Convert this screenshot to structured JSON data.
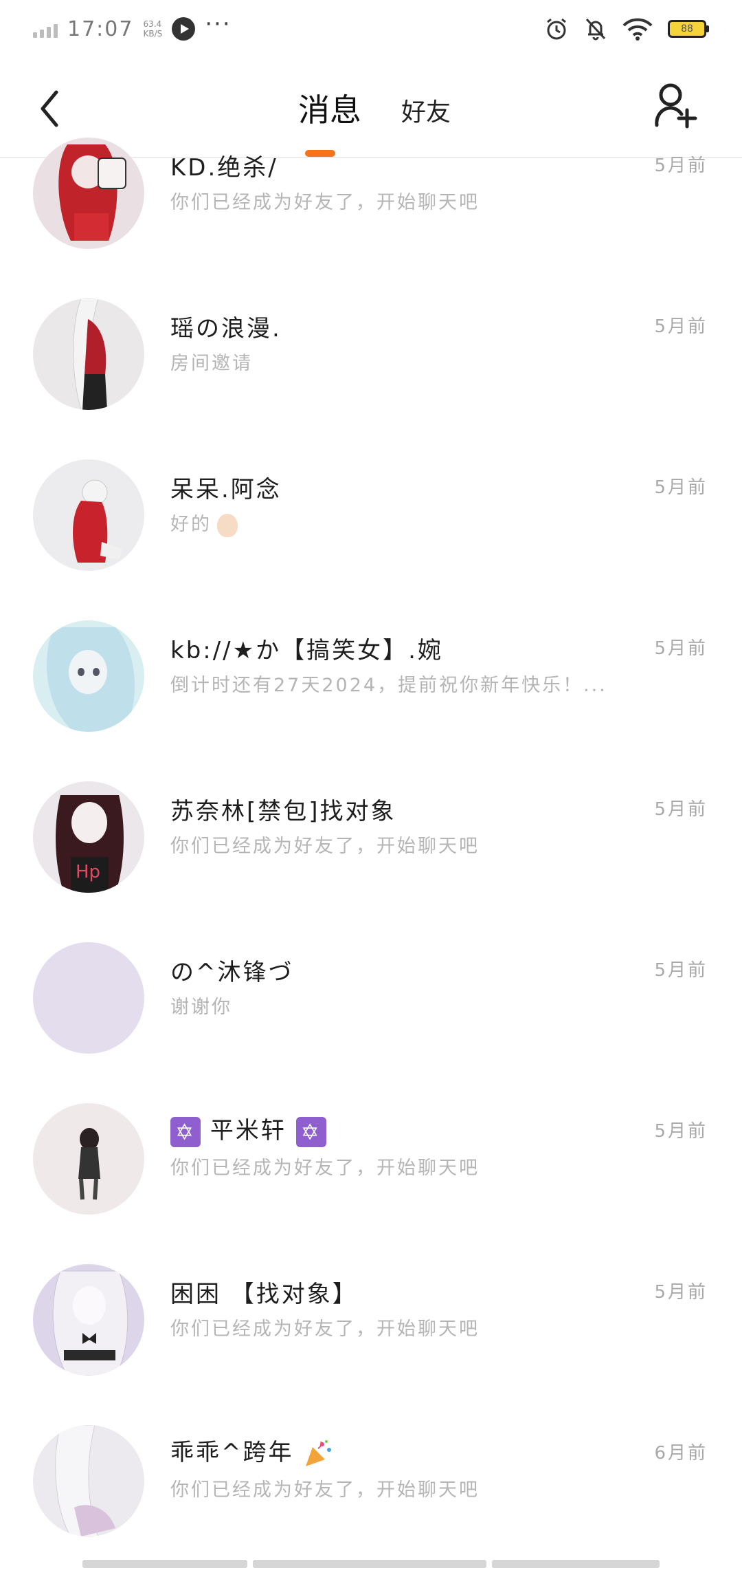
{
  "status_bar": {
    "time": "17:07",
    "speed_value": "63.4",
    "speed_unit": "KB/S",
    "more": "···",
    "battery": "88"
  },
  "header": {
    "tab_messages": "消息",
    "tab_friends": "好友",
    "accent_color": "#f5731c"
  },
  "conversations": [
    {
      "name": "KD.绝杀/",
      "preview": "你们已经成为好友了，开始聊天吧",
      "time": "5月前"
    },
    {
      "name": "瑶の浪漫.",
      "preview": "房间邀请",
      "time": "5月前"
    },
    {
      "name": "呆呆.阿念",
      "preview": "好的",
      "time": "5月前"
    },
    {
      "name": "kb://★か【搞笑女】.婉",
      "preview": "倒计时还有27天2024，提前祝你新年快乐！...",
      "time": "5月前"
    },
    {
      "name": "苏奈林[禁包]找对象",
      "preview": "你们已经成为好友了，开始聊天吧",
      "time": "5月前"
    },
    {
      "name": "の^沐锋づ",
      "preview": "谢谢你",
      "time": "5月前"
    },
    {
      "name": "平米轩",
      "preview": "你们已经成为好友了，开始聊天吧",
      "time": "5月前"
    },
    {
      "name": "困困 【找对象】",
      "preview": "你们已经成为好友了，开始聊天吧",
      "time": "5月前"
    },
    {
      "name": "乖乖^跨年",
      "preview": "你们已经成为好友了，开始聊天吧",
      "time": "6月前"
    }
  ]
}
